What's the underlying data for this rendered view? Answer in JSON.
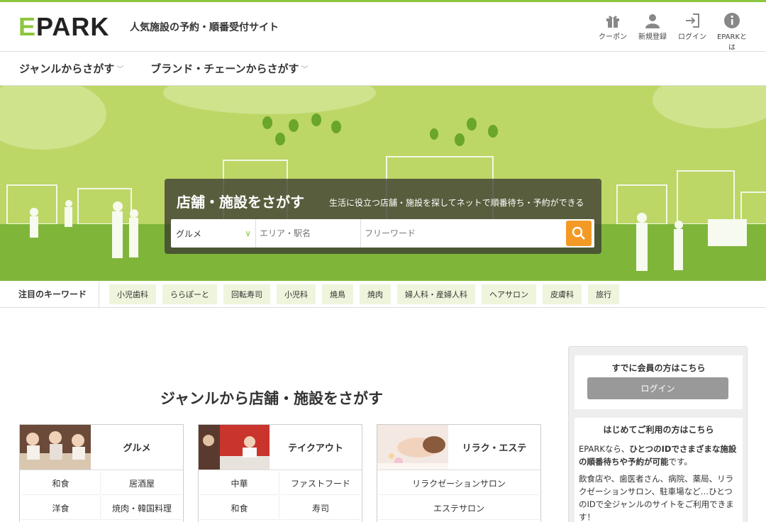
{
  "header": {
    "logo": "PARK",
    "logo_e": "E",
    "tagline": "人気施設の予約・順番受付サイト",
    "links": [
      {
        "label": "クーポン",
        "icon": "gift-icon"
      },
      {
        "label": "新規登録",
        "icon": "user-icon"
      },
      {
        "label": "ログイン",
        "icon": "login-icon"
      },
      {
        "label": "EPARKとは",
        "icon": "info-icon"
      }
    ]
  },
  "genre_nav": [
    {
      "label": "ジャンルからさがす"
    },
    {
      "label": "ブランド・チェーンからさがす"
    }
  ],
  "search": {
    "title": "店舗・施設をさがす",
    "subtitle": "生活に役立つ店舗・施設を探してネットで順番待ち・予約ができる",
    "genre_value": "グルメ",
    "area_placeholder": "エリア・駅名",
    "free_placeholder": "フリーワード"
  },
  "keywords": {
    "label": "注目のキーワード",
    "items": [
      "小児歯科",
      "ららぽーと",
      "回転寿司",
      "小児科",
      "焼鳥",
      "焼肉",
      "婦人科・産婦人科",
      "ヘアサロン",
      "皮膚科",
      "旅行"
    ]
  },
  "main": {
    "title": "ジャンルから店舗・施設をさがす",
    "cards": [
      {
        "name": "グルメ",
        "subs": [
          "和食",
          "居酒屋",
          "洋食",
          "焼肉・韓国料理"
        ]
      },
      {
        "name": "テイクアウト",
        "subs": [
          "中華",
          "ファストフード",
          "和食",
          "寿司"
        ]
      },
      {
        "name": "リラク・エステ",
        "subs": [
          "リラクゼーションサロン",
          "エステサロン"
        ]
      }
    ]
  },
  "sidebar": {
    "member_title": "すでに会員の方はこちら",
    "login_label": "ログイン",
    "first_title": "はじめてご利用の方はこちら",
    "intro_1": "EPARKなら、",
    "intro_bold": "ひとつのIDでさまざまな施設の順番待ちや予約が可能",
    "intro_2": "です。",
    "desc": "飲食店や、歯医者さん、病院、薬局、リラクゼーションサロン、駐車場など…ひとつのIDで全ジャンルのサイトをご利用できます！"
  },
  "colors": {
    "accent": "#8cc63e",
    "hero": "#bcd766",
    "search_button": "#f39a26"
  }
}
